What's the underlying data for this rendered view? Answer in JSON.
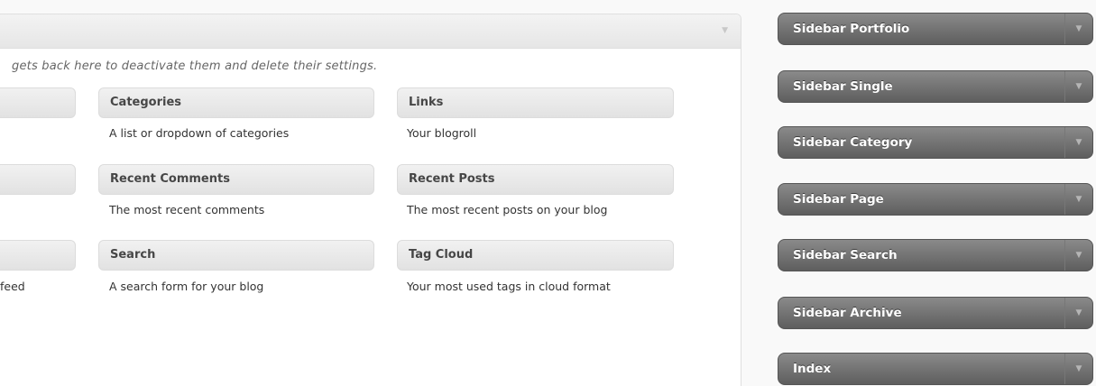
{
  "available_widgets": {
    "description": "gets back here to deactivate them and delete their settings.",
    "collapse_icon": "triangle-down-icon",
    "widgets": [
      {
        "title": "Categories",
        "description": "A list or dropdown of categories"
      },
      {
        "title": "Links",
        "description": "Your blogroll"
      },
      {
        "title": "Recent Comments",
        "description": "The most recent comments"
      },
      {
        "title": "Recent Posts",
        "description": "The most recent posts on your blog"
      },
      {
        "title": "Search",
        "description": "A search form for your blog"
      },
      {
        "title": "Tag Cloud",
        "description": "Your most used tags in cloud format"
      }
    ],
    "partial_description_fragment": "feed"
  },
  "sidebars": [
    {
      "label": "Sidebar Portfolio",
      "toggle_icon": "triangle-down-icon"
    },
    {
      "label": "Sidebar Single",
      "toggle_icon": "triangle-down-icon"
    },
    {
      "label": "Sidebar Category",
      "toggle_icon": "triangle-down-icon"
    },
    {
      "label": "Sidebar Page",
      "toggle_icon": "triangle-down-icon"
    },
    {
      "label": "Sidebar Search",
      "toggle_icon": "triangle-down-icon"
    },
    {
      "label": "Sidebar Archive",
      "toggle_icon": "triangle-down-icon"
    },
    {
      "label": "Index",
      "toggle_icon": "triangle-down-icon"
    }
  ],
  "colors": {
    "sidebar_bar": "#6e6e6e",
    "widget_bar": "#e8e8e8",
    "page_background": "#f9f9f9"
  }
}
